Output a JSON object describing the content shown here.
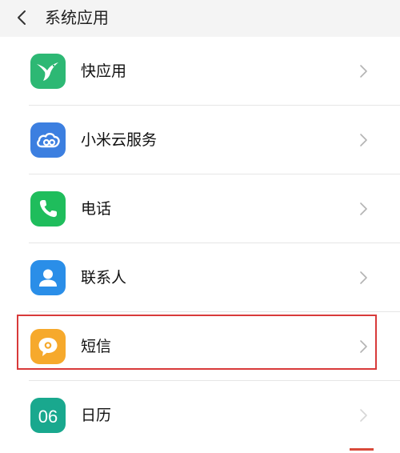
{
  "header": {
    "title": "系统应用",
    "back_icon": "chevron-left-icon"
  },
  "items": [
    {
      "id": "quickapp",
      "label": "快应用",
      "icon": "hummingbird-icon",
      "icon_color": "#2db874"
    },
    {
      "id": "xiaomi-cloud",
      "label": "小米云服务",
      "icon": "cloud-icon",
      "icon_color": "#3c7fe0"
    },
    {
      "id": "phone",
      "label": "电话",
      "icon": "phone-icon",
      "icon_color": "#1fbd5c"
    },
    {
      "id": "contacts",
      "label": "联系人",
      "icon": "person-icon",
      "icon_color": "#2a8ee8"
    },
    {
      "id": "messages",
      "label": "短信",
      "icon": "chat-bubble-icon",
      "icon_color": "#f6a92c",
      "highlighted": true
    },
    {
      "id": "calendar",
      "label": "日历",
      "icon": "calendar-icon",
      "icon_color": "#19a88e",
      "icon_text": "06"
    }
  ],
  "colors": {
    "header_bg": "#f4f4f4",
    "divider": "#e6e6e6",
    "chevron": "#b3b3b3",
    "highlight": "#d83a3a"
  }
}
